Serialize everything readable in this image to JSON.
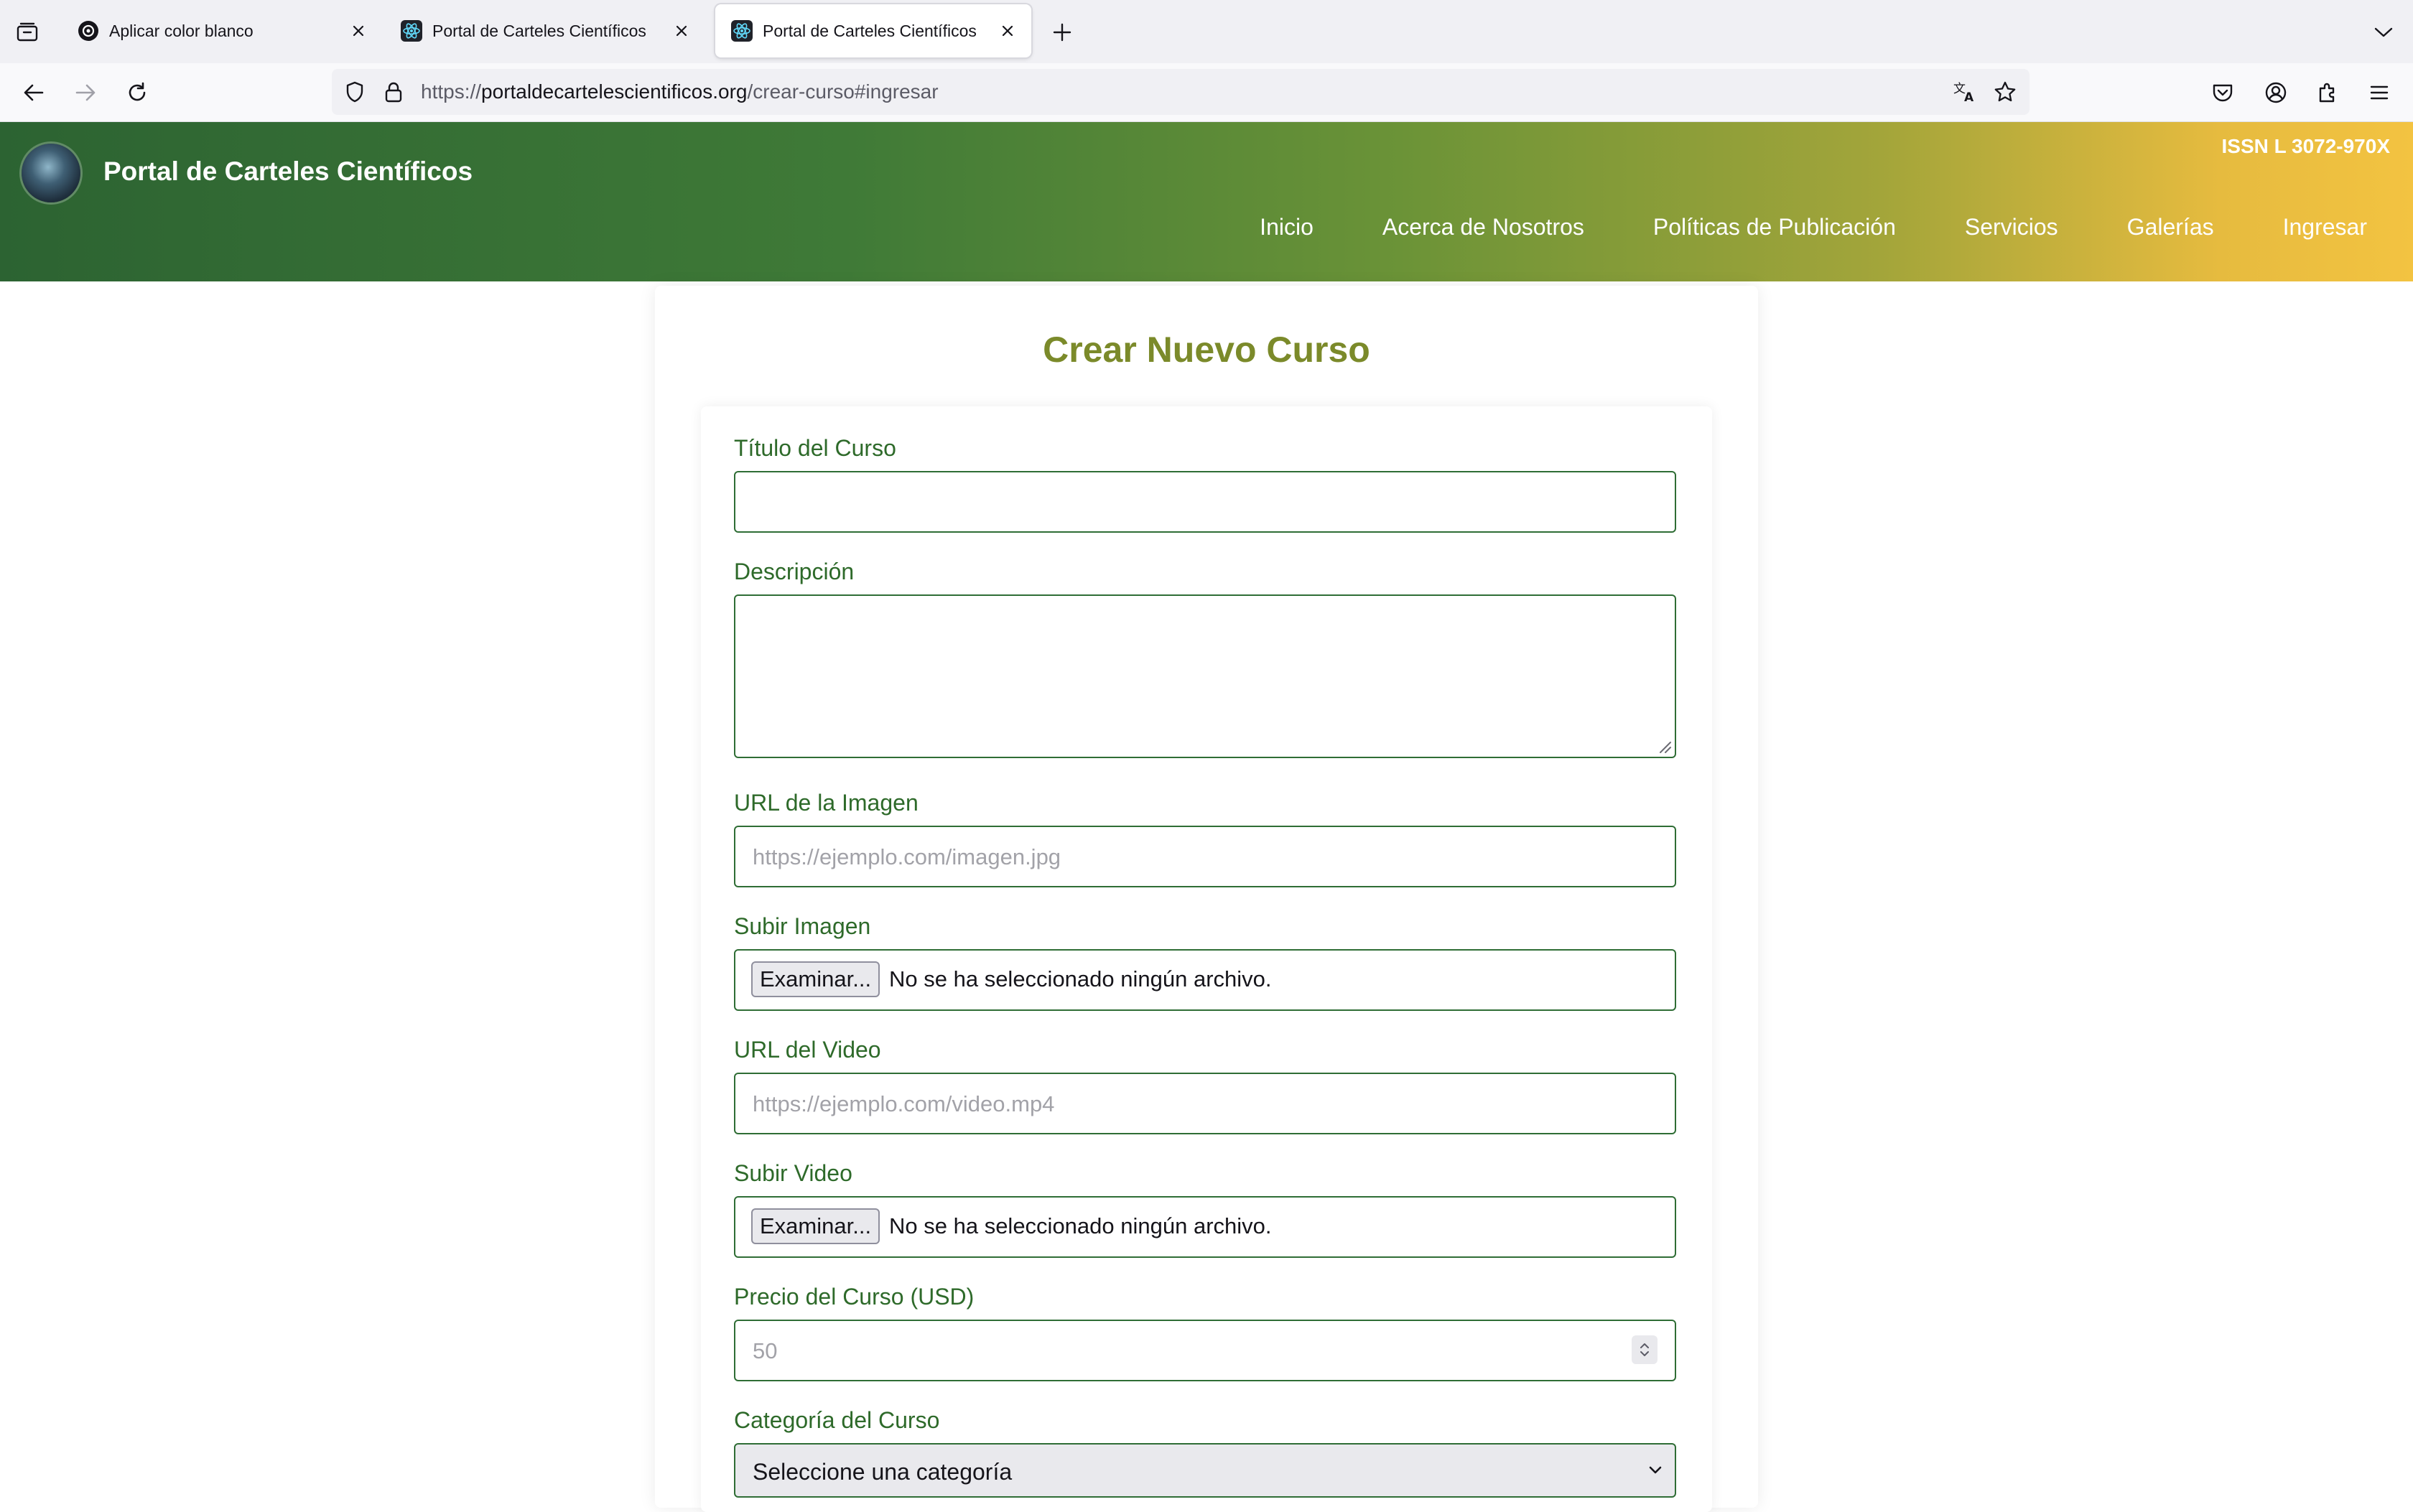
{
  "browser": {
    "tabs": [
      {
        "title": "Aplicar color blanco",
        "active": false
      },
      {
        "title": "Portal de Carteles Científicos",
        "active": false
      },
      {
        "title": "Portal de Carteles Científicos",
        "active": true
      }
    ],
    "url": {
      "scheme": "https://",
      "host": "portaldecartelescientificos.org",
      "path": "/crear-curso#ingresar"
    }
  },
  "site": {
    "title": "Portal de Carteles Científicos",
    "issn": "ISSN L 3072-970X",
    "nav": [
      "Inicio",
      "Acerca de Nosotros",
      "Políticas de Publicación",
      "Servicios",
      "Galerías",
      "Ingresar"
    ]
  },
  "form": {
    "heading": "Crear Nuevo Curso",
    "title_label": "Título del Curso",
    "title_value": "",
    "description_label": "Descripción",
    "description_value": "",
    "image_url_label": "URL de la Imagen",
    "image_url_placeholder": "https://ejemplo.com/imagen.jpg",
    "upload_image_label": "Subir Imagen",
    "browse_label": "Examinar...",
    "no_file_text": "No se ha seleccionado ningún archivo.",
    "video_url_label": "URL del Video",
    "video_url_placeholder": "https://ejemplo.com/video.mp4",
    "upload_video_label": "Subir Video",
    "price_label": "Precio del Curso (USD)",
    "price_placeholder": "50",
    "category_label": "Categoría del Curso",
    "category_selected": "Seleccione una categoría"
  },
  "colors": {
    "header_start": "#2c6332",
    "header_end": "#f3c341",
    "heading": "#7b8a2a",
    "label": "#2e6a2a",
    "field_border": "#2f6d35"
  }
}
